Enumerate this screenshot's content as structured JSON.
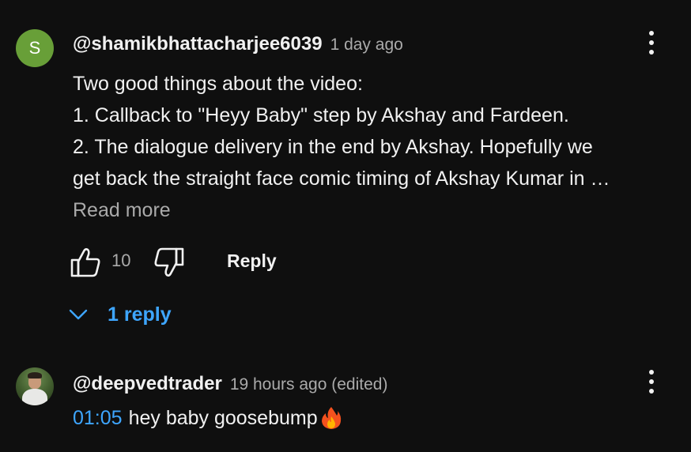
{
  "comments": [
    {
      "avatar_letter": "S",
      "avatar_color": "#689f38",
      "author": "@shamikbhattacharjee6039",
      "time": "1 day ago",
      "lines": [
        "Two good things about the video:",
        "1. Callback to \"Heyy Baby\" step by Akshay and Fardeen.",
        "2. The dialogue delivery in the end by Akshay. Hopefully we",
        "get back the straight face comic timing of Akshay Kumar in …"
      ],
      "read_more": "Read more",
      "like_count": "10",
      "reply_label": "Reply",
      "replies_label": "1 reply"
    },
    {
      "author": "@deepvedtrader",
      "time": "19 hours ago (edited)",
      "timestamp": "01:05",
      "text": "hey baby goosebump",
      "emoji": "fire-emoji"
    }
  ],
  "icons": {
    "like": "thumbs-up-icon",
    "dislike": "thumbs-down-icon",
    "menu": "more-vert-icon",
    "expand": "chevron-down-icon"
  },
  "colors": {
    "background": "#0f0f0f",
    "text": "#f1f1f1",
    "secondary": "#aaaaaa",
    "link": "#3ea6ff"
  }
}
